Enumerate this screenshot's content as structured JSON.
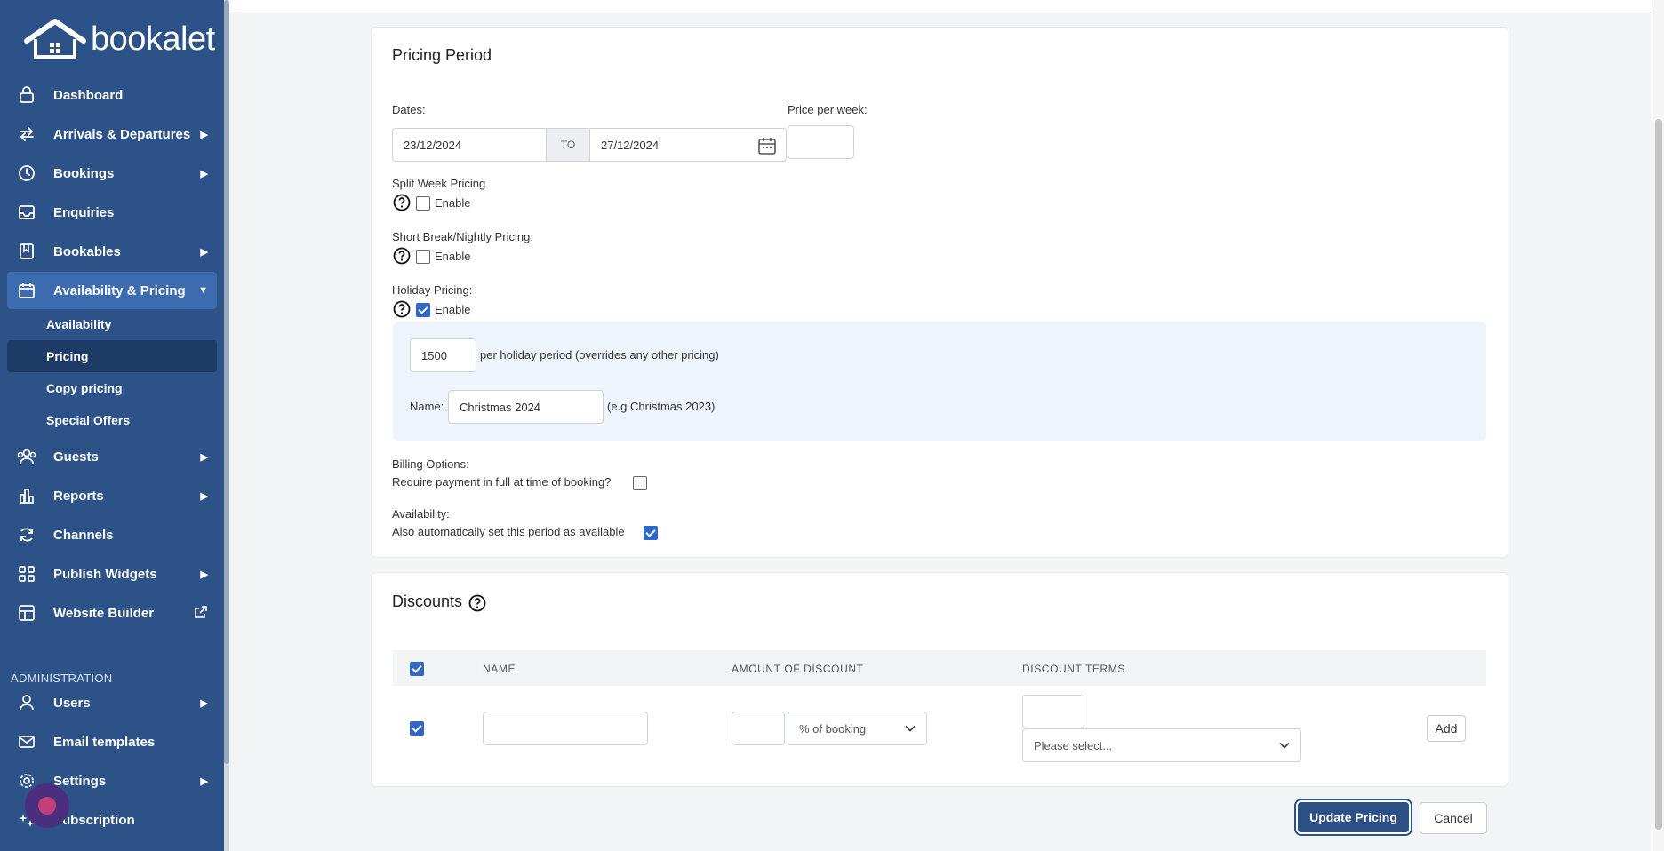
{
  "brand": {
    "logo_text": "bookalet"
  },
  "sidebar": {
    "items": [
      {
        "label": "Dashboard",
        "icon": "lock-icon",
        "has_arrow": false
      },
      {
        "label": "Arrivals & Departures",
        "icon": "swap-arrows-icon",
        "has_arrow": true
      },
      {
        "label": "Bookings",
        "icon": "clock-icon",
        "has_arrow": true
      },
      {
        "label": "Enquiries",
        "icon": "inbox-icon",
        "has_arrow": false
      },
      {
        "label": "Bookables",
        "icon": "book-icon",
        "has_arrow": true
      },
      {
        "label": "Availability & Pricing",
        "icon": "calendar-icon",
        "has_arrow": true,
        "expanded": true
      },
      {
        "label": "Guests",
        "icon": "users-icon",
        "has_arrow": true
      },
      {
        "label": "Reports",
        "icon": "bar-chart-icon",
        "has_arrow": true
      },
      {
        "label": "Channels",
        "icon": "refresh-icon",
        "has_arrow": false
      },
      {
        "label": "Publish Widgets",
        "icon": "grid-icon",
        "has_arrow": true
      },
      {
        "label": "Website Builder",
        "icon": "layout-icon",
        "has_arrow": false,
        "external": true
      }
    ],
    "sub_items": [
      {
        "label": "Availability"
      },
      {
        "label": "Pricing",
        "active": true
      },
      {
        "label": "Copy pricing"
      },
      {
        "label": "Special Offers"
      }
    ],
    "admin_label": "ADMINISTRATION",
    "admin_items": [
      {
        "label": "Users",
        "has_arrow": true
      },
      {
        "label": "Email templates",
        "has_arrow": false
      },
      {
        "label": "Settings",
        "has_arrow": true
      },
      {
        "label": "Subscription",
        "has_arrow": false
      }
    ]
  },
  "pricing_period": {
    "title": "Pricing Period",
    "dates_label": "Dates:",
    "date_from": "23/12/2024",
    "to_label": "TO",
    "date_to": "27/12/2024",
    "price_label": "Price per week:",
    "price_value": "",
    "split_week_label": "Split Week Pricing",
    "split_week_enable": "Enable",
    "short_break_label": "Short Break/Nightly Pricing:",
    "short_break_enable": "Enable",
    "holiday_label": "Holiday Pricing:",
    "holiday_enable": "Enable",
    "holiday_price": "1500",
    "holiday_price_suffix": "per holiday period (overrides any other pricing)",
    "holiday_name_label": "Name:",
    "holiday_name": "Christmas 2024",
    "holiday_name_hint": "(e.g Christmas 2023)",
    "billing_label": "Billing Options:",
    "billing_text": "Require payment in full at time of booking?",
    "availability_label": "Availability:",
    "availability_text": "Also automatically set this period as available"
  },
  "discounts": {
    "title": "Discounts",
    "columns": [
      "NAME",
      "AMOUNT OF DISCOUNT",
      "DISCOUNT TERMS"
    ],
    "amount_unit": "% of booking",
    "terms_placeholder": "Please select...",
    "add_label": "Add"
  },
  "actions": {
    "update_label": "Update Pricing",
    "cancel_label": "Cancel"
  },
  "colors": {
    "sidebar": "#2c5288",
    "sidebar_active": "#3d6bb0",
    "sub_active": "#1e3a66",
    "primary": "#2c4f86",
    "checkbox": "#2f66c8"
  }
}
